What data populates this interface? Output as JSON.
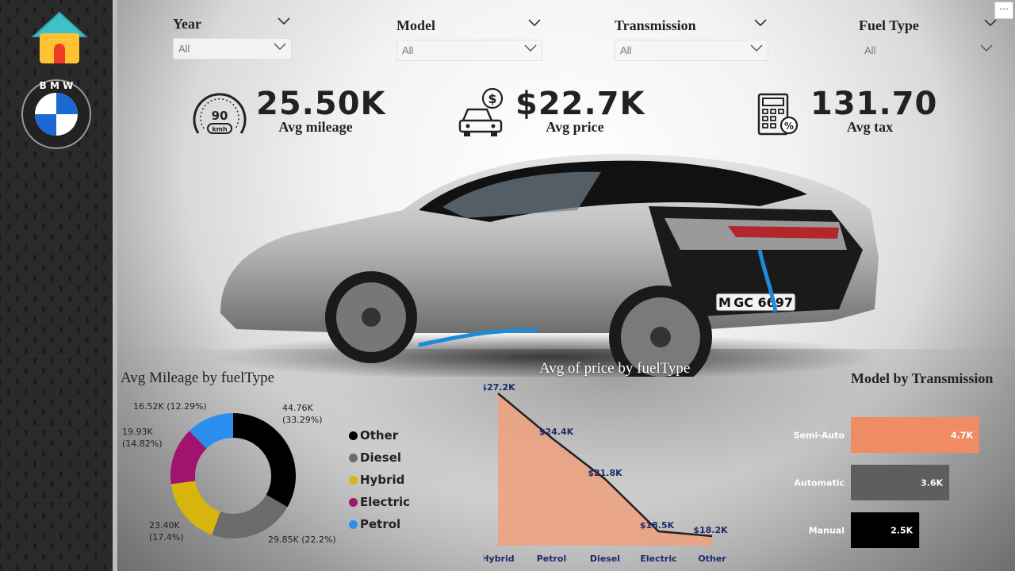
{
  "slicers": [
    {
      "title": "Year",
      "value": "All"
    },
    {
      "title": "Model",
      "value": "All"
    },
    {
      "title": "Transmission",
      "value": "All"
    },
    {
      "title": "Fuel Type",
      "value": "All"
    }
  ],
  "kpis": {
    "mileage": {
      "value": "25.50K",
      "label": "Avg mileage",
      "gauge_text": "90",
      "gauge_unit": "kmh"
    },
    "price": {
      "value": "$22.7K",
      "label": "Avg price"
    },
    "tax": {
      "value": "131.70",
      "label": "Avg tax"
    }
  },
  "car": {
    "plate": "M GC 6697"
  },
  "colors": {
    "other": "#000000",
    "diesel": "#6b6b6b",
    "hybrid": "#d8b40f",
    "electric": "#a0136f",
    "petrol": "#2a8ef0",
    "area": "#f0a07c",
    "bar_semi": "#ef8c63",
    "bar_auto": "#5e5e5e",
    "bar_manual": "#000000"
  },
  "chart_data": [
    {
      "type": "pie",
      "title": "Avg Mileage by fuelType",
      "categories": [
        "Other",
        "Diesel",
        "Hybrid",
        "Electric",
        "Petrol"
      ],
      "values": [
        44.76,
        29.85,
        23.4,
        19.93,
        16.52
      ],
      "unit": "K",
      "data_labels": [
        "44.76K (33.29%)",
        "29.85K (22.2%)",
        "23.40K (17.4%)",
        "19.93K (14.82%)",
        "16.52K (12.29%)"
      ],
      "legend": [
        "Other",
        "Diesel",
        "Hybrid",
        "Electric",
        "Petrol"
      ],
      "legend_position": "right"
    },
    {
      "type": "area",
      "title": "Avg of price by fuelType",
      "categories": [
        "Hybrid",
        "Petrol",
        "Diesel",
        "Electric",
        "Other"
      ],
      "values": [
        27.2,
        24.4,
        21.8,
        18.5,
        18.2
      ],
      "data_labels": [
        "$27.2K",
        "$24.4K",
        "$21.8K",
        "$18.5K",
        "$18.2K"
      ],
      "ylim": [
        17.6,
        27.2
      ]
    },
    {
      "type": "bar",
      "orientation": "horizontal",
      "title": "Model by Transmission",
      "categories": [
        "Semi-Auto",
        "Automatic",
        "Manual"
      ],
      "values": [
        4.7,
        3.6,
        2.5
      ],
      "data_labels": [
        "4.7K",
        "3.6K",
        "2.5K"
      ],
      "xlim": [
        0,
        4.7
      ]
    }
  ]
}
